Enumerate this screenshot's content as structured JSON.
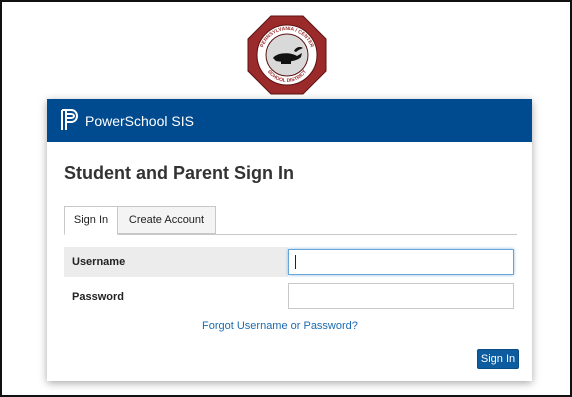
{
  "district_logo": {
    "arc_text_top": "PENNSYLVANIA / CENTER",
    "arc_text_bottom": "SCHOOL DISTRICT",
    "colors": {
      "ring": "#9b2a2b",
      "inner": "#d9d9d9",
      "lamp": "#111111"
    }
  },
  "header": {
    "brand": "PowerSchool SIS",
    "icon": "powerschool-logo-icon",
    "background": "#004a8f"
  },
  "page": {
    "title": "Student and Parent Sign In"
  },
  "tabs": [
    {
      "label": "Sign In",
      "active": true
    },
    {
      "label": "Create Account",
      "active": false
    }
  ],
  "form": {
    "username_label": "Username",
    "password_label": "Password",
    "username_value": "",
    "password_value": "",
    "forgot_link": "Forgot Username or Password?",
    "submit_label": "Sign In"
  }
}
